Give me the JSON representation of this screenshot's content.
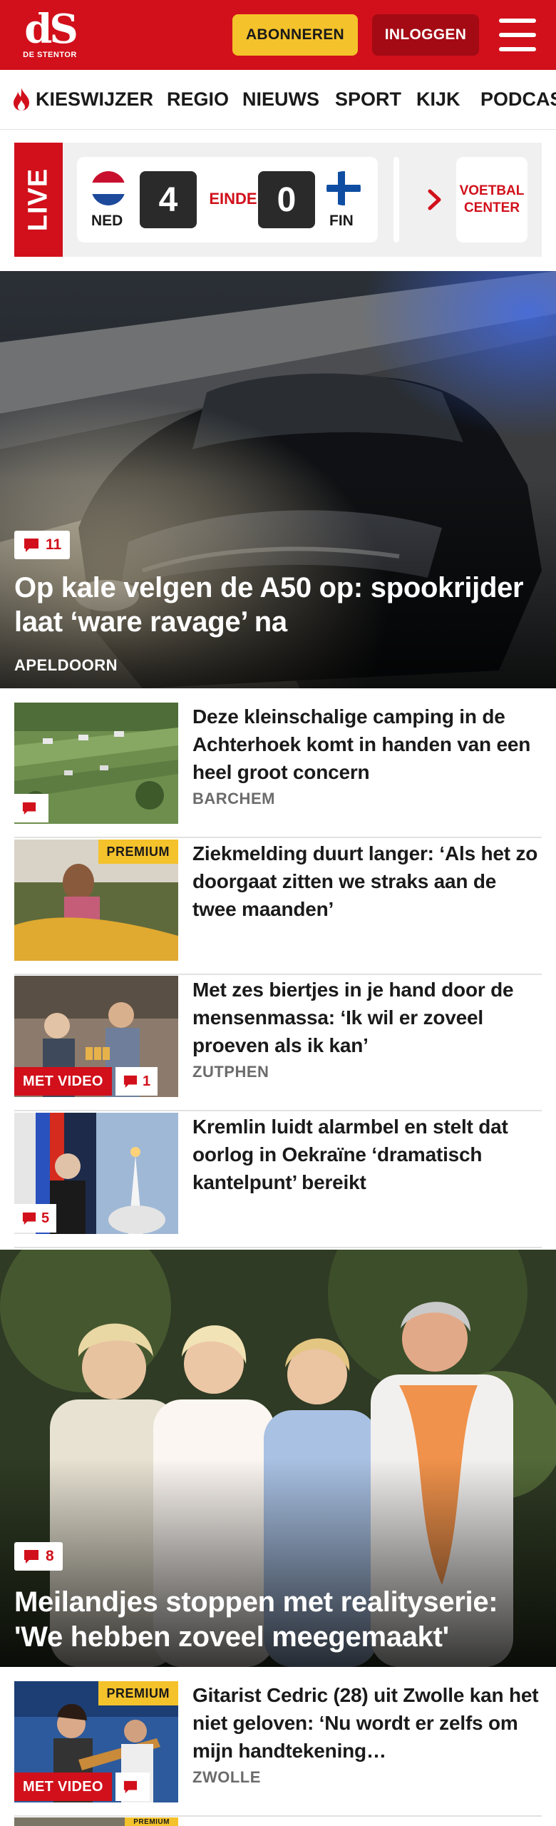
{
  "header": {
    "logo_mark": "dS",
    "logo_sub": "DE STENTOR",
    "subscribe_label": "ABONNEREN",
    "login_label": "INLOGGEN",
    "brand_color": "#d1101b",
    "accent_color": "#f4c22b"
  },
  "nav": {
    "items": [
      "KIESWIJZER",
      "REGIO",
      "NIEUWS",
      "SPORT",
      "KIJK",
      "PODCAS"
    ]
  },
  "live": {
    "tag": "LIVE",
    "match": {
      "home_code": "NED",
      "home_score": "4",
      "status": "EINDE",
      "away_score": "0",
      "away_code": "FIN"
    },
    "voetbal_center": "VOETBAL CENTER"
  },
  "hero": {
    "comments": "11",
    "title": "Op kale velgen de A50 op: spookrijder laat ‘ware ravage’ na",
    "location": "APELDOORN"
  },
  "articles": [
    {
      "title": "Deze kleinschalige camping in de Achterhoek komt in handen van een heel groot concern",
      "location": "BARCHEM",
      "comments": "",
      "premium": "",
      "video": ""
    },
    {
      "title": "Ziekmelding duurt langer: ‘Als het zo doorgaat zitten we straks aan de twee maanden’",
      "location": "",
      "comments": "",
      "premium": "PREMIUM",
      "video": ""
    },
    {
      "title": "Met zes biertjes in je hand door de mensenmassa: ‘Ik wil er zoveel proeven als ik kan’",
      "location": "ZUTPHEN",
      "comments": "1",
      "premium": "",
      "video": "MET VIDEO"
    },
    {
      "title": "Kremlin luidt alarmbel en stelt dat oorlog in Oekraïne ‘dramatisch kantelpunt’ bereikt",
      "location": "",
      "comments": "5",
      "premium": "",
      "video": ""
    }
  ],
  "hero2": {
    "comments": "8",
    "title": "Meilandjes stoppen met realityserie: 'We hebben zoveel meegemaakt'"
  },
  "article_bottom": {
    "title": "Gitarist Cedric (28) uit Zwolle kan het niet geloven: ‘Nu wordt er zelfs om mijn handtekening…",
    "location": "ZWOLLE",
    "premium": "PREMIUM",
    "video": "MET VIDEO"
  },
  "article_peek": {
    "premium": "PREMIUM"
  }
}
